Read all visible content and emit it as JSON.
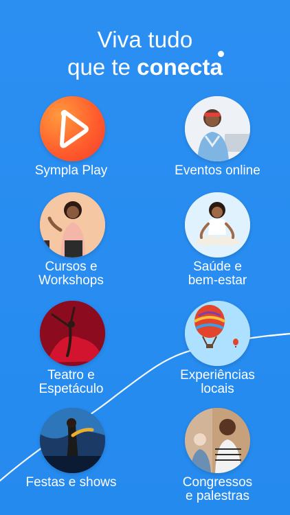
{
  "headline": {
    "line1": "Viva tudo",
    "line2_prefix": "que te ",
    "line2_brand": "conecta"
  },
  "categories": [
    {
      "label": "Sympla Play",
      "icon": "play-icon"
    },
    {
      "label": "Eventos online",
      "icon": "laptop-user-photo"
    },
    {
      "label": "Cursos e\nWorkshops",
      "icon": "instructor-photo"
    },
    {
      "label": "Saúde e\nbem-estar",
      "icon": "meditation-photo"
    },
    {
      "label": "Teatro e\nEspetáculo",
      "icon": "dancer-photo"
    },
    {
      "label": "Experiências\nlocais",
      "icon": "hot-air-balloon-photo"
    },
    {
      "label": "Festas e shows",
      "icon": "concert-photo"
    },
    {
      "label": "Congressos\ne palestras",
      "icon": "conference-photo"
    }
  ],
  "colors": {
    "background": "#2a8cf0",
    "text": "#ffffff",
    "play_gradient_start": "#ff9a3d",
    "play_gradient_end": "#ef3e2e"
  }
}
